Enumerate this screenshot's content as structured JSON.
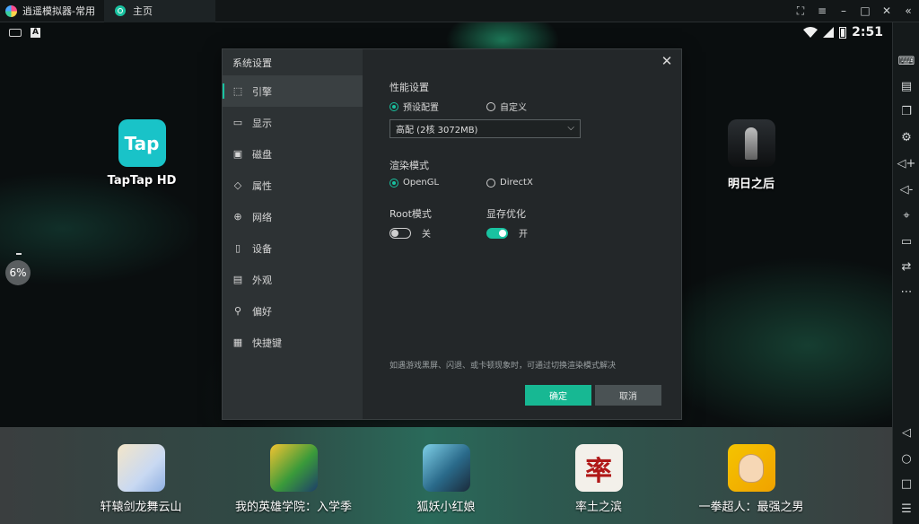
{
  "titlebar": {
    "app_title": "逍遥模拟器-常用",
    "tab_label": "主页",
    "controls": [
      "⛶",
      "≡",
      "–",
      "□",
      "✕",
      "«"
    ]
  },
  "statusbar": {
    "ime_badge": "A",
    "time": "2:51"
  },
  "desktop": {
    "apps": [
      {
        "label": "TapTap HD",
        "icon_text": "Tap"
      },
      {
        "label": "明日之后"
      }
    ],
    "perf_value": "6%"
  },
  "dialog": {
    "title": "系统设置",
    "nav": [
      {
        "label": "引擎",
        "icon": "⬚"
      },
      {
        "label": "显示",
        "icon": "▭"
      },
      {
        "label": "磁盘",
        "icon": "▣"
      },
      {
        "label": "属性",
        "icon": "◇"
      },
      {
        "label": "网络",
        "icon": "⊕"
      },
      {
        "label": "设备",
        "icon": "▯"
      },
      {
        "label": "外观",
        "icon": "▤"
      },
      {
        "label": "偏好",
        "icon": "⚲"
      },
      {
        "label": "快捷键",
        "icon": "▦"
      }
    ],
    "performance": {
      "label": "性能设置",
      "option_preset": "预设配置",
      "option_custom": "自定义",
      "select_value": "高配 (2核 3072MB)"
    },
    "render": {
      "label": "渲染模式",
      "option_opengl": "OpenGL",
      "option_directx": "DirectX"
    },
    "root": {
      "label": "Root模式",
      "state_text": "关"
    },
    "memory": {
      "label": "显存优化",
      "state_text": "开"
    },
    "hint": "如遇游戏黑屏、闪退、或卡顿现象时，可通过切换渲染模式解决",
    "ok_label": "确定",
    "cancel_label": "取消"
  },
  "dock": {
    "apps": [
      {
        "label": "轩辕剑龙舞云山"
      },
      {
        "label": "我的英雄学院：入学季"
      },
      {
        "label": "狐妖小红娘"
      },
      {
        "label": "率土之滨",
        "icon_text": "率"
      },
      {
        "label": "一拳超人：最强之男"
      }
    ]
  },
  "rightbar": {
    "buttons": [
      "⌨",
      "▤",
      "❐",
      "⚙",
      "◁+",
      "◁-",
      "⌖",
      "▭",
      "⇄",
      "⋯",
      "◁",
      "○",
      "□",
      "☰"
    ]
  }
}
